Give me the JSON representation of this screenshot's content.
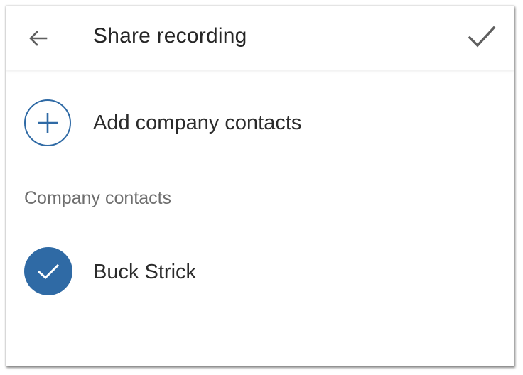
{
  "header": {
    "title": "Share recording",
    "back_icon": "arrow-left-icon",
    "confirm_icon": "checkmark-icon"
  },
  "add_contacts": {
    "label": "Add company contacts",
    "icon": "plus-circle-icon"
  },
  "section": {
    "title": "Company contacts"
  },
  "contacts": [
    {
      "name": "Buck Strick",
      "selected": true,
      "icon": "check-circle-icon"
    }
  ],
  "colors": {
    "accent": "#2f6aa5",
    "text_primary": "#2b2b2b",
    "text_secondary": "#6e6e6e",
    "icon_gray": "#5f5f5f"
  }
}
